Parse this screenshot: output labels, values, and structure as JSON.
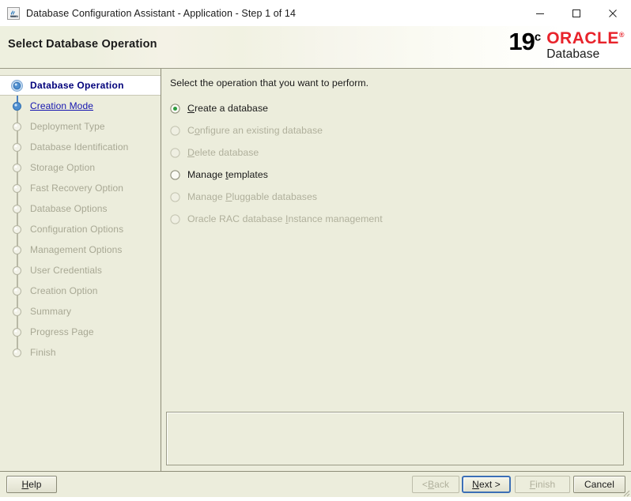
{
  "window": {
    "title": "Database Configuration Assistant - Application - Step 1 of 14",
    "icon": "java-app-icon",
    "controls": {
      "minimize": "minimize-icon",
      "maximize": "maximize-icon",
      "close": "close-icon"
    }
  },
  "header": {
    "title": "Select Database Operation",
    "logo": {
      "version": "19",
      "version_sup": "c",
      "brand": "ORACLE",
      "brand_sup": "®",
      "product": "Database",
      "brand_color": "#E8232B"
    }
  },
  "sidebar": {
    "steps": [
      {
        "label": "Database Operation",
        "state": "current"
      },
      {
        "label": "Creation Mode",
        "state": "link"
      },
      {
        "label": "Deployment Type",
        "state": "disabled"
      },
      {
        "label": "Database Identification",
        "state": "disabled"
      },
      {
        "label": "Storage Option",
        "state": "disabled"
      },
      {
        "label": "Fast Recovery Option",
        "state": "disabled"
      },
      {
        "label": "Database Options",
        "state": "disabled"
      },
      {
        "label": "Configuration Options",
        "state": "disabled"
      },
      {
        "label": "Management Options",
        "state": "disabled"
      },
      {
        "label": "User Credentials",
        "state": "disabled"
      },
      {
        "label": "Creation Option",
        "state": "disabled"
      },
      {
        "label": "Summary",
        "state": "disabled"
      },
      {
        "label": "Progress Page",
        "state": "disabled"
      },
      {
        "label": "Finish",
        "state": "disabled"
      }
    ]
  },
  "main": {
    "prompt": "Select the operation that you want to perform.",
    "options": [
      {
        "label": "Create a database",
        "mnemonic": "C",
        "selected": true,
        "enabled": true
      },
      {
        "label": "Configure an existing database",
        "mnemonic": "o",
        "selected": false,
        "enabled": false
      },
      {
        "label": "Delete database",
        "mnemonic": "D",
        "selected": false,
        "enabled": false
      },
      {
        "label": "Manage templates",
        "mnemonic": "t",
        "selected": false,
        "enabled": true
      },
      {
        "label": "Manage Pluggable databases",
        "mnemonic": "P",
        "selected": false,
        "enabled": false
      },
      {
        "label": "Oracle RAC database Instance management",
        "mnemonic": "I",
        "selected": false,
        "enabled": false
      }
    ],
    "message_panel_text": ""
  },
  "buttons": {
    "help": {
      "label": "Help",
      "mnemonic": "H",
      "enabled": true,
      "focused": false
    },
    "back": {
      "label": "< Back",
      "mnemonic": "B",
      "enabled": false,
      "focused": false
    },
    "next": {
      "label": "Next >",
      "mnemonic": "N",
      "enabled": true,
      "focused": true
    },
    "finish": {
      "label": "Finish",
      "mnemonic": "F",
      "enabled": false,
      "focused": false
    },
    "cancel": {
      "label": "Cancel",
      "mnemonic": "",
      "enabled": true,
      "focused": false
    }
  }
}
